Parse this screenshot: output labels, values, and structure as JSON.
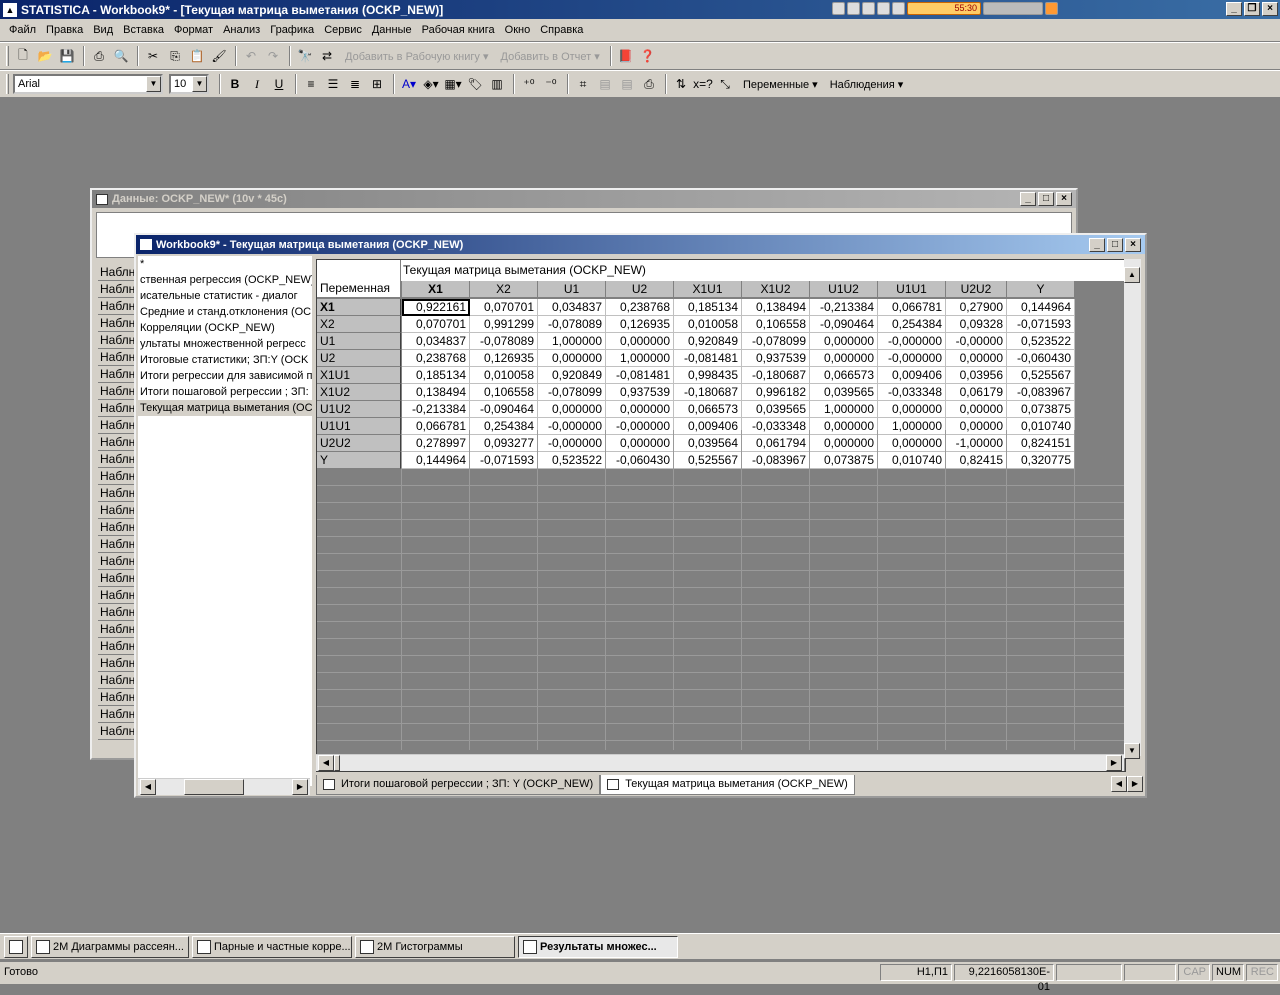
{
  "app": {
    "title": "STATISTICA - Workbook9* - [Текущая матрица выметания (OCKP_NEW)]",
    "media_display": "55:30"
  },
  "menu": [
    "Файл",
    "Правка",
    "Вид",
    "Вставка",
    "Формат",
    "Анализ",
    "Графика",
    "Сервис",
    "Данные",
    "Рабочая книга",
    "Окно",
    "Справка"
  ],
  "toolbar1": {
    "add_workbook": "Добавить в Рабочую книгу ▾",
    "add_report": "Добавить в Отчет ▾"
  },
  "toolbar2": {
    "font": "Arial",
    "size": "10",
    "variables": "Переменные ▾",
    "observations": "Наблюдения ▾"
  },
  "data_window": {
    "title": "Данные: OCKP_NEW* (10v * 45c)",
    "row_label": "Наблн"
  },
  "workbook_window": {
    "title": "Workbook9* - Текущая матрица выметания (OCKP_NEW)",
    "tree": [
      "*",
      "ственная регрессия (OCKP_NEW)",
      "исательные статистик - диалог",
      "Средние и станд.отклонения (OC",
      "Корреляции (OCKP_NEW)",
      "ультаты множественной регресс",
      "Итоговые статистики; ЗП:Y (OCK",
      " Итоги регрессии для зависимой п",
      "Итоги пошаговой регрессии ; ЗП:",
      "Текущая матрица выметания (OC"
    ],
    "tabs": [
      "Итоги пошаговой регрессии ; ЗП: Y (OCKP_NEW)",
      "Текущая матрица выметания (OCKP_NEW)"
    ]
  },
  "sheet": {
    "title": "Текущая матрица выметания (OCKP_NEW)",
    "corner": "Переменная",
    "columns": [
      "X1",
      "X2",
      "U1",
      "U2",
      "X1U1",
      "X1U2",
      "U1U2",
      "U1U1",
      "U2U2",
      "Y"
    ],
    "rows": [
      {
        "name": "X1",
        "values": [
          "0,922161",
          "0,070701",
          "0,034837",
          "0,238768",
          "0,185134",
          "0,138494",
          "-0,213384",
          "0,066781",
          "0,27900",
          "0,144964"
        ]
      },
      {
        "name": "X2",
        "values": [
          "0,070701",
          "0,991299",
          "-0,078089",
          "0,126935",
          "0,010058",
          "0,106558",
          "-0,090464",
          "0,254384",
          "0,09328",
          "-0,071593"
        ]
      },
      {
        "name": "U1",
        "values": [
          "0,034837",
          "-0,078089",
          "1,000000",
          "0,000000",
          "0,920849",
          "-0,078099",
          "0,000000",
          "-0,000000",
          "-0,00000",
          "0,523522"
        ]
      },
      {
        "name": "U2",
        "values": [
          "0,238768",
          "0,126935",
          "0,000000",
          "1,000000",
          "-0,081481",
          "0,937539",
          "0,000000",
          "-0,000000",
          "0,00000",
          "-0,060430"
        ]
      },
      {
        "name": "X1U1",
        "values": [
          "0,185134",
          "0,010058",
          "0,920849",
          "-0,081481",
          "0,998435",
          "-0,180687",
          "0,066573",
          "0,009406",
          "0,03956",
          "0,525567"
        ]
      },
      {
        "name": "X1U2",
        "values": [
          "0,138494",
          "0,106558",
          "-0,078099",
          "0,937539",
          "-0,180687",
          "0,996182",
          "0,039565",
          "-0,033348",
          "0,06179",
          "-0,083967"
        ]
      },
      {
        "name": "U1U2",
        "values": [
          "-0,213384",
          "-0,090464",
          "0,000000",
          "0,000000",
          "0,066573",
          "0,039565",
          "1,000000",
          "0,000000",
          "0,00000",
          "0,073875"
        ]
      },
      {
        "name": "U1U1",
        "values": [
          "0,066781",
          "0,254384",
          "-0,000000",
          "-0,000000",
          "0,009406",
          "-0,033348",
          "0,000000",
          "1,000000",
          "0,00000",
          "0,010740"
        ]
      },
      {
        "name": "U2U2",
        "values": [
          "0,278997",
          "0,093277",
          "-0,000000",
          "0,000000",
          "0,039564",
          "0,061794",
          "0,000000",
          "0,000000",
          "-1,00000",
          "0,824151"
        ]
      },
      {
        "name": "Y",
        "values": [
          "0,144964",
          "-0,071593",
          "0,523522",
          "-0,060430",
          "0,525567",
          "-0,083967",
          "0,073875",
          "0,010740",
          "0,82415",
          "0,320775"
        ]
      }
    ]
  },
  "taskbar": [
    "2М Диаграммы рассеян...",
    "Парные и частные корре...",
    "2М Гистограммы",
    "Результаты множес..."
  ],
  "status": {
    "text": "Готово",
    "cell": "Н1,П1",
    "value": "9,2216058130E-01",
    "cap": "CAP",
    "num": "NUM",
    "rec": "REC"
  }
}
